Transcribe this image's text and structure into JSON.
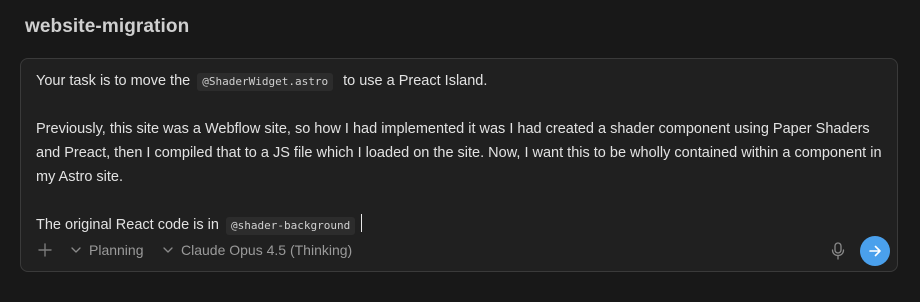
{
  "project": {
    "title": "website-migration"
  },
  "composer": {
    "message": {
      "line1_before": "Your task is to move the",
      "line1_code": "@ShaderWidget.astro",
      "line1_after": "to use a Preact Island.",
      "paragraph2": "Previously, this site was a Webflow site, so how I had implemented it was I had created a shader component using Paper Shaders and Preact, then I compiled that to a JS file which I loaded on the site. Now, I want this to be wholly contained within a component in my Astro site.",
      "line3_before": "The original React code is in",
      "line3_code": "@shader-background"
    },
    "toolbar": {
      "add_icon": "plus-icon",
      "mode_label": "Planning",
      "model_label": "Claude Opus 4.5 (Thinking)",
      "mic_icon": "microphone-icon",
      "send_icon": "arrow-right-icon"
    }
  },
  "colors": {
    "background": "#181818",
    "composer_bg": "#202020",
    "composer_border": "#3a3a3a",
    "send_button": "#4aa0ec",
    "code_bg": "#2c2c2c"
  }
}
